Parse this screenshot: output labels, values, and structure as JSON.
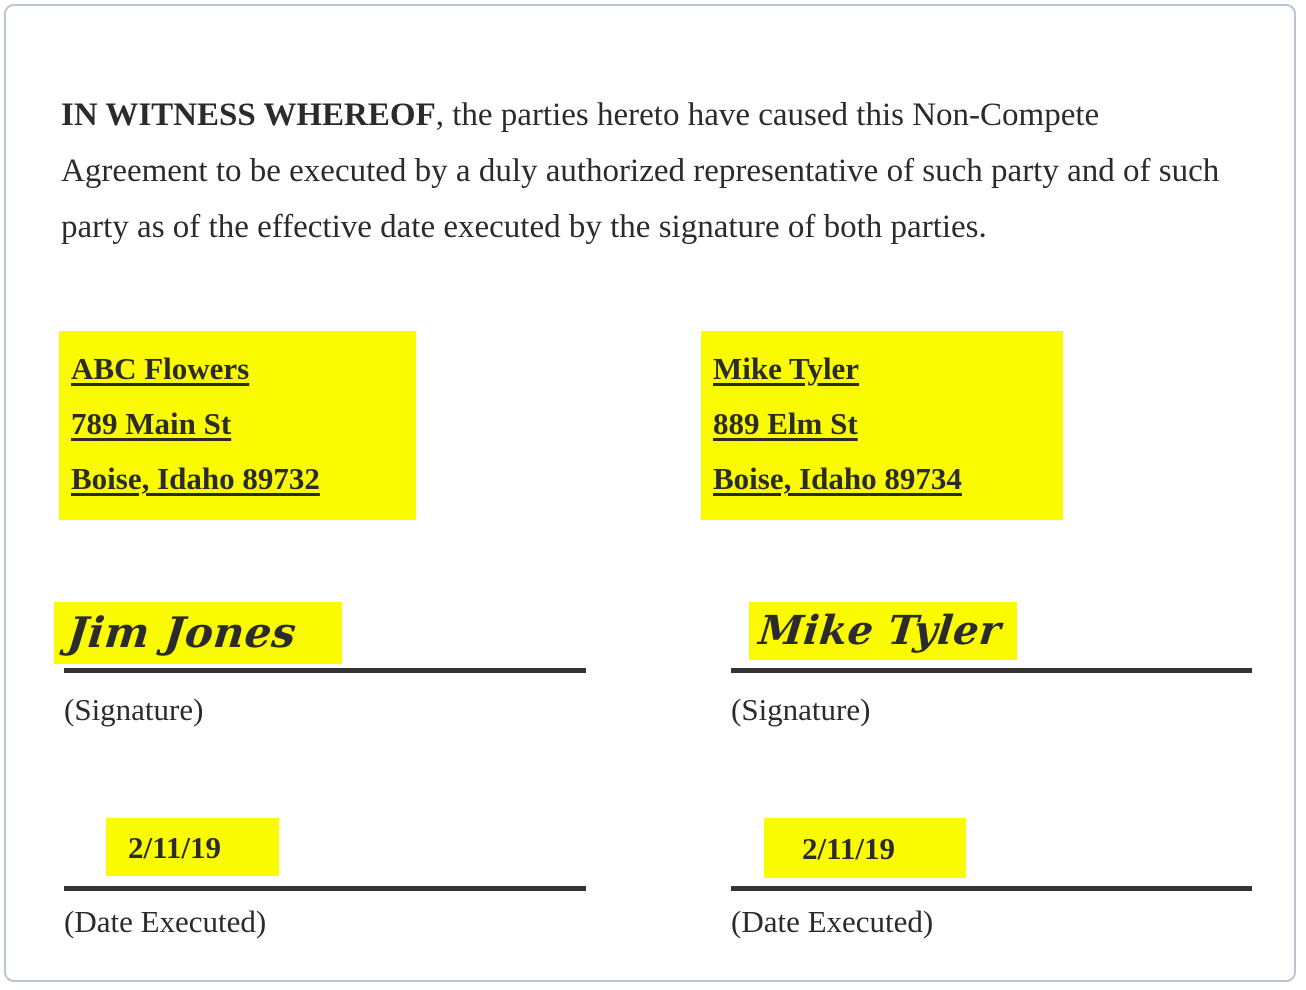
{
  "document": {
    "type": "non-compete-agreement-signature-page",
    "border_color": "#b9c6d4",
    "highlight_color": "#fbfb00",
    "text_color": "#2b2b2b",
    "rule_color": "#333333"
  },
  "paragraph": {
    "lead": "IN WITNESS WHEREOF",
    "body": ", the parties hereto have caused this Non-Compete Agreement to be executed by a duly authorized representative of such party and of such party as of the effective date executed by the signature of both parties."
  },
  "parties": [
    {
      "side": "left",
      "address": {
        "line1": "ABC Flowers",
        "line2": "789 Main St",
        "line3": "Boise, Idaho 89732"
      },
      "signature": {
        "value": "Jim Jones",
        "caption": "(Signature)"
      },
      "date": {
        "value": "2/11/19",
        "caption": "(Date Executed)"
      }
    },
    {
      "side": "right",
      "address": {
        "line1": "Mike Tyler",
        "line2": "889 Elm St",
        "line3": "Boise, Idaho 89734"
      },
      "signature": {
        "value": "Mike Tyler",
        "caption": "(Signature)"
      },
      "date": {
        "value": "2/11/19",
        "caption": "(Date Executed)"
      }
    }
  ]
}
